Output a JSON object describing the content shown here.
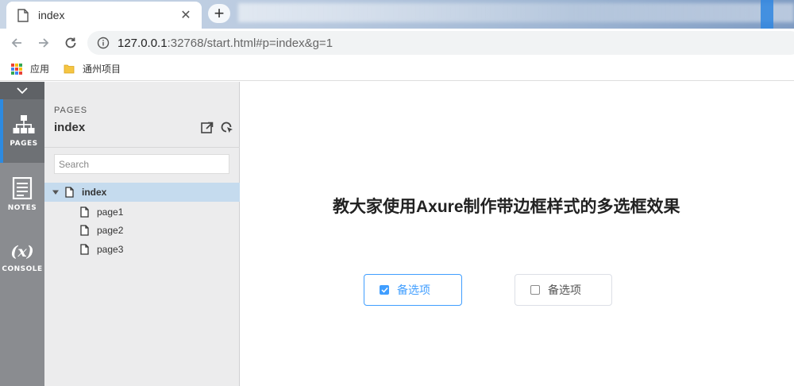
{
  "browser": {
    "tab_title": "index",
    "tab_close": "✕",
    "new_tab": "+",
    "url_host": "127.0.0.1",
    "url_rest": ":32768/start.html#p=index&g=1"
  },
  "bookmarks": [
    {
      "label": "应用"
    },
    {
      "label": "通州项目"
    }
  ],
  "rail": {
    "items": [
      {
        "label": "PAGES",
        "active": true
      },
      {
        "label": "NOTES",
        "active": false
      },
      {
        "label": "CONSOLE",
        "active": false,
        "symbol": "(x)"
      }
    ]
  },
  "pages_panel": {
    "kicker": "PAGES",
    "title": "index",
    "search_placeholder": "Search",
    "tree": [
      {
        "label": "index",
        "selected": true,
        "level": 0
      },
      {
        "label": "page1",
        "selected": false,
        "level": 1
      },
      {
        "label": "page2",
        "selected": false,
        "level": 1
      },
      {
        "label": "page3",
        "selected": false,
        "level": 1
      }
    ]
  },
  "canvas": {
    "headline": "教大家使用Axure制作带边框样式的多选框效果",
    "options": [
      {
        "label": "备选项",
        "checked": true
      },
      {
        "label": "备选项",
        "checked": false
      }
    ]
  },
  "colors": {
    "accent": "#409eff",
    "rail": "#8a8c90",
    "panel": "#ececed",
    "selected_row": "#c5dbee"
  }
}
